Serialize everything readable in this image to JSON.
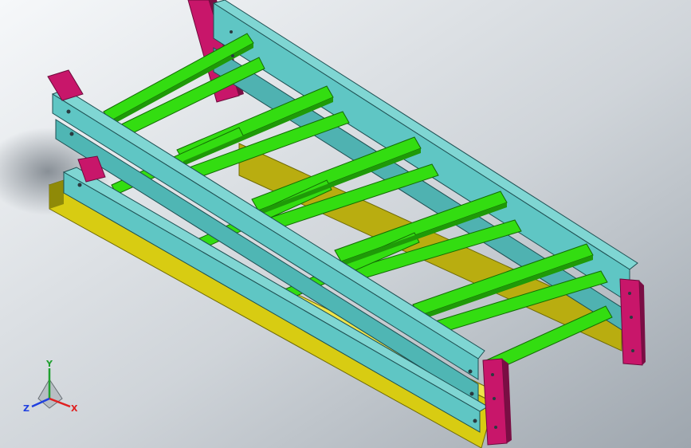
{
  "scene": {
    "background_top": "#f4f6f8",
    "background_bottom": "#a7aeb6",
    "colors": {
      "rail": "#5fc6c4",
      "rail_dark": "#2f8f93",
      "rail_edge": "#1e4f52",
      "roller": "#33dd11",
      "roller_dark": "#1f9a08",
      "base": "#d8cc12",
      "base_dark": "#8f8a08",
      "leg": "#c8166a",
      "leg_dark": "#7a0e44",
      "bolt": "#9aa7b0"
    }
  },
  "triad": {
    "x_label": "X",
    "y_label": "Y",
    "z_label": "Z",
    "x_color": "#e02020",
    "y_color": "#20a030",
    "z_color": "#2040e0"
  }
}
